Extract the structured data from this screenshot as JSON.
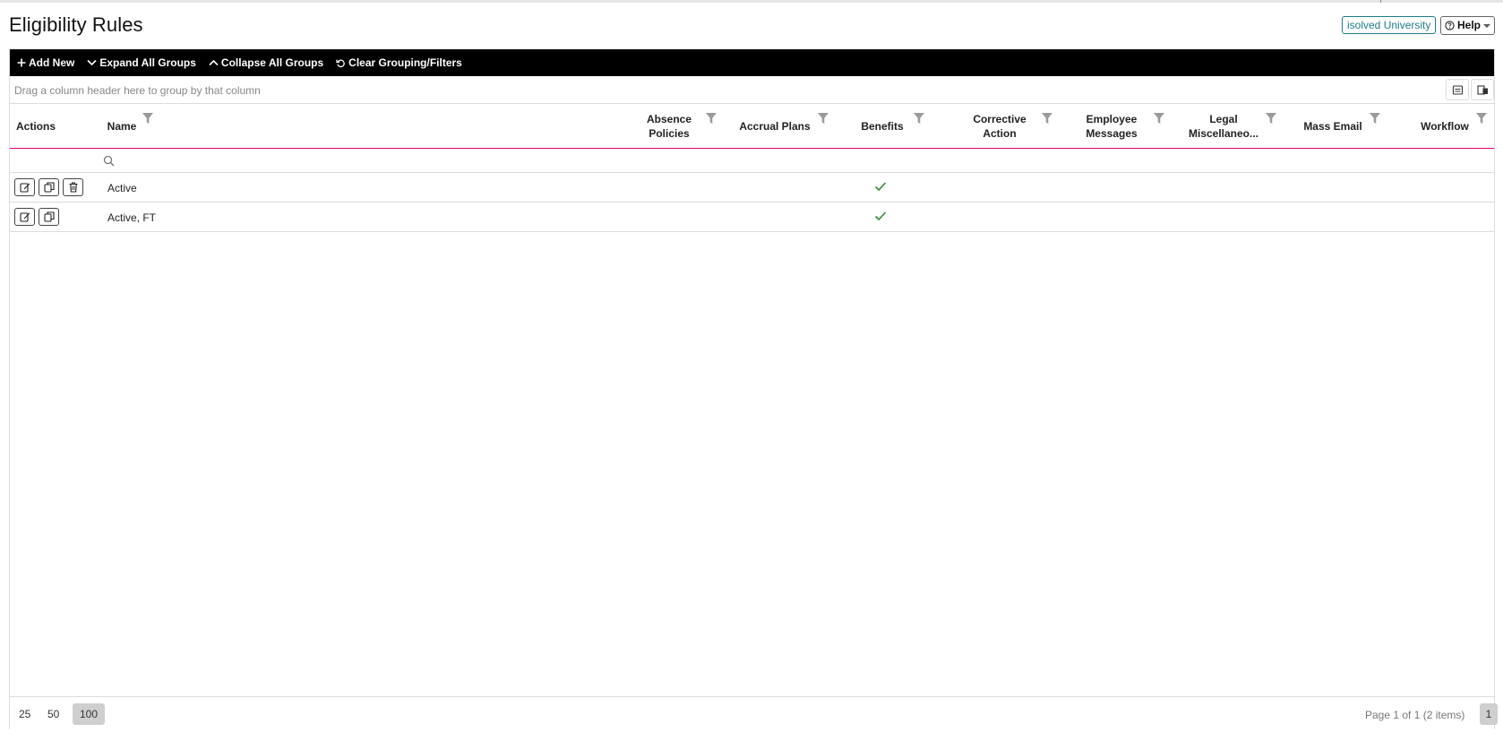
{
  "page": {
    "title": "Eligibility Rules"
  },
  "header": {
    "university_link": "isolved University",
    "help_label": "Help"
  },
  "toolbar": {
    "add_new": "Add New",
    "expand_all": "Expand All Groups",
    "collapse_all": "Collapse All Groups",
    "clear": "Clear Grouping/Filters"
  },
  "grid": {
    "group_hint": "Drag a column header here to group by that column",
    "columns": {
      "actions": "Actions",
      "name": "Name",
      "absence_policies_1": "Absence",
      "absence_policies_2": "Policies",
      "accrual_plans": "Accrual Plans",
      "benefits": "Benefits",
      "corrective_action_1": "Corrective",
      "corrective_action_2": "Action",
      "employee_messages_1": "Employee",
      "employee_messages_2": "Messages",
      "legal_misc_1": "Legal",
      "legal_misc_2": "Miscellaneo...",
      "mass_email": "Mass Email",
      "workflow": "Workflow"
    },
    "rows": [
      {
        "name": "Active",
        "benefits": true,
        "actions": [
          "edit",
          "copy",
          "delete"
        ]
      },
      {
        "name": "Active, FT",
        "benefits": true,
        "actions": [
          "edit",
          "copy"
        ]
      }
    ]
  },
  "footer": {
    "page_sizes": [
      "25",
      "50",
      "100"
    ],
    "active_page_size": "100",
    "pager_info": "Page 1 of 1 (2 items)",
    "current_page": "1"
  },
  "colors": {
    "toolbar_bg": "#000000",
    "accent_line": "#e0006a",
    "link": "#1d7d8c",
    "check": "#2e8b2e"
  }
}
